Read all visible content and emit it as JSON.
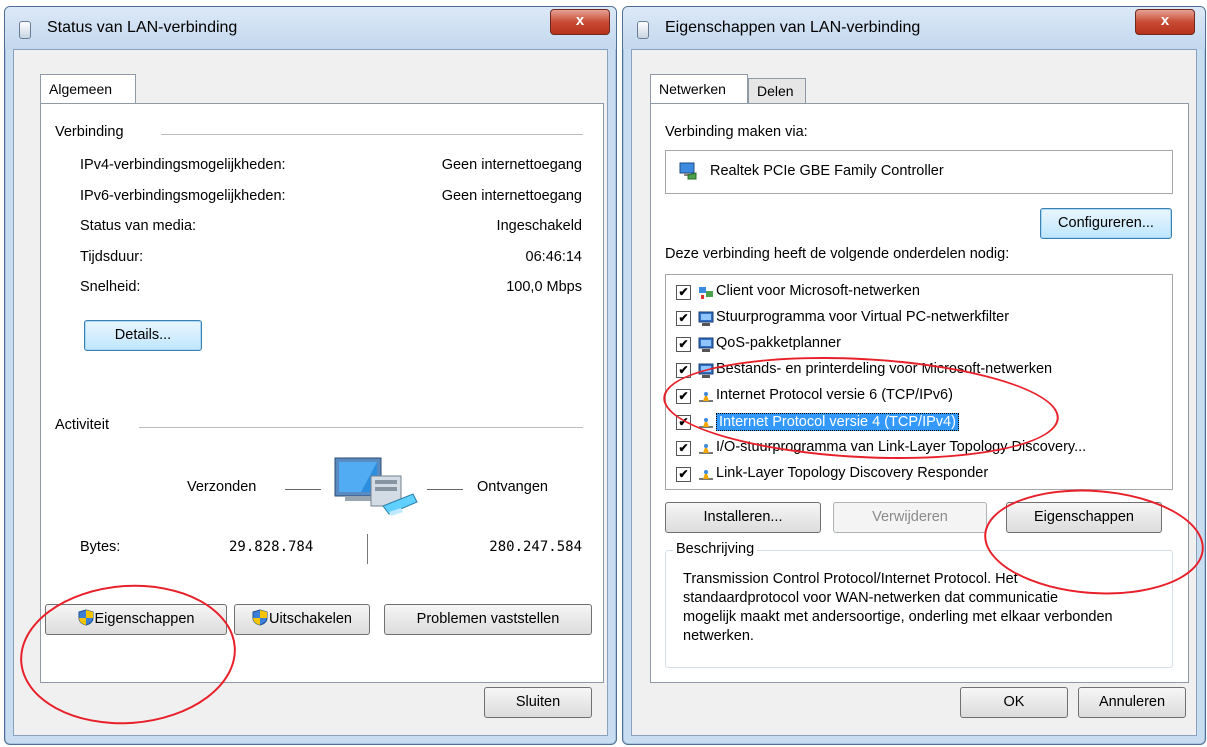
{
  "status_window": {
    "title": "Status van LAN-verbinding",
    "close_label": "x",
    "tab_label": "Algemeen",
    "connection_section": "Verbinding",
    "rows": [
      {
        "label": "IPv4-verbindingsmogelijkheden:",
        "value": "Geen internettoegang"
      },
      {
        "label": "IPv6-verbindingsmogelijkheden:",
        "value": "Geen internettoegang"
      },
      {
        "label": "Status van media:",
        "value": "Ingeschakeld"
      },
      {
        "label": "Tijdsduur:",
        "value": "06:46:14"
      },
      {
        "label": "Snelheid:",
        "value": "100,0 Mbps"
      }
    ],
    "details_button": "Details...",
    "activity_section": "Activiteit",
    "sent_label": "Verzonden",
    "received_label": "Ontvangen",
    "bytes_label": "Bytes:",
    "bytes_sent": "29.828.784",
    "bytes_received": "280.247.584",
    "properties_button": "Eigenschappen",
    "disable_button": "Uitschakelen",
    "diagnose_button": "Problemen vaststellen",
    "close_button": "Sluiten"
  },
  "properties_window": {
    "title": "Eigenschappen van LAN-verbinding",
    "close_label": "x",
    "tabs": [
      "Netwerken",
      "Delen"
    ],
    "connect_using_label": "Verbinding maken via:",
    "adapter_name": "Realtek PCIe GBE Family Controller",
    "configure_button": "Configureren...",
    "components_label": "Deze verbinding heeft de volgende onderdelen nodig:",
    "components": [
      {
        "label": "Client voor Microsoft-netwerken",
        "checked": true,
        "icon": "network-client-icon"
      },
      {
        "label": "Stuurprogramma voor Virtual PC-netwerkfilter",
        "checked": true,
        "icon": "computer-service-icon"
      },
      {
        "label": "QoS-pakketplanner",
        "checked": true,
        "icon": "computer-service-icon"
      },
      {
        "label": "Bestands- en printerdeling voor Microsoft-netwerken",
        "checked": true,
        "icon": "computer-service-icon"
      },
      {
        "label": "Internet Protocol versie 6 (TCP/IPv6)",
        "checked": true,
        "icon": "protocol-icon"
      },
      {
        "label": "Internet Protocol versie 4 (TCP/IPv4)",
        "checked": true,
        "icon": "protocol-icon",
        "selected": true
      },
      {
        "label": "I/O-stuurprogramma van Link-Layer Topology Discovery...",
        "checked": true,
        "icon": "protocol-icon"
      },
      {
        "label": "Link-Layer Topology Discovery Responder",
        "checked": true,
        "icon": "protocol-icon"
      }
    ],
    "install_button": "Installeren...",
    "remove_button": "Verwijderen",
    "properties_button": "Eigenschappen",
    "description_label": "Beschrijving",
    "description_text": "Transmission Control Protocol/Internet Protocol. Het standaardprotocol voor WAN-netwerken dat communicatie mogelijk maakt met andersoortige, onderling met elkaar verbonden netwerken.",
    "ok_button": "OK",
    "cancel_button": "Annuleren"
  },
  "colors": {
    "annotation_red": "#e8202a",
    "selection_blue": "#3399ff"
  }
}
